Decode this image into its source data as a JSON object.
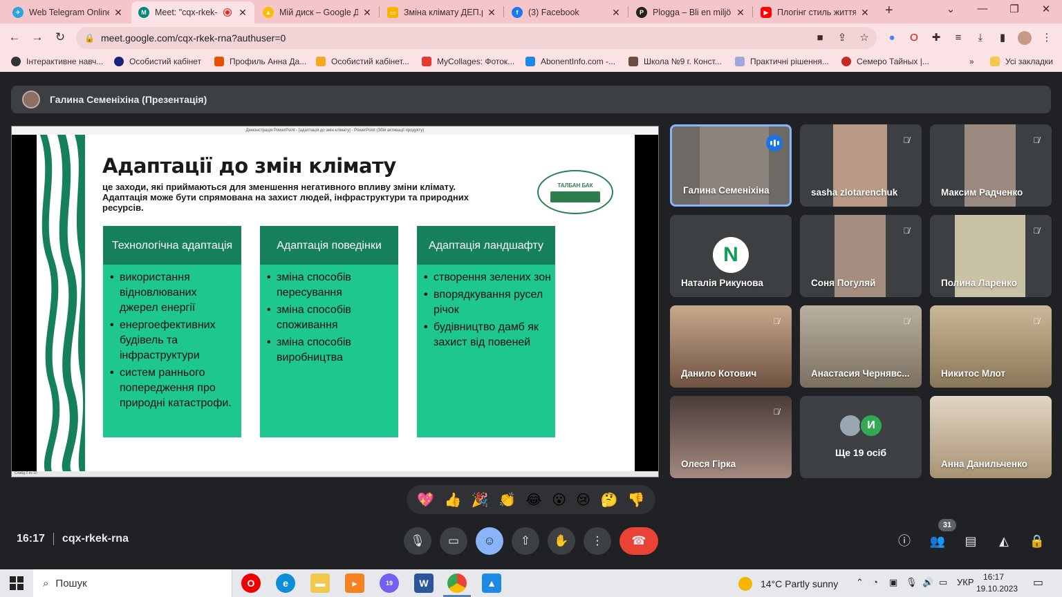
{
  "browser": {
    "tabs": [
      {
        "title": "Web Telegram Online",
        "fav_color": "#2aa3e0",
        "fav_glyph": "✈"
      },
      {
        "title": "Meet: \"cqx-rkek-",
        "fav_color": "#00897b",
        "fav_glyph": "M",
        "recording": true
      },
      {
        "title": "Мій диск – Google Д",
        "fav_color": "#fbbc04",
        "fav_glyph": "▲"
      },
      {
        "title": "Зміна клімату ДЕП.р",
        "fav_color": "#f4b400",
        "fav_glyph": "▭"
      },
      {
        "title": "(3) Facebook",
        "fav_color": "#1877f2",
        "fav_glyph": "f"
      },
      {
        "title": "Plogga – Bli en miljö",
        "fav_color": "#222222",
        "fav_glyph": "P"
      },
      {
        "title": "Плогінг стиль життя",
        "fav_color": "#ff0000",
        "fav_glyph": "▶"
      }
    ],
    "url": "meet.google.com/cqx-rkek-rna?authuser=0",
    "bookmarks": [
      {
        "label": "Інтерактивне навч...",
        "color": "#333333"
      },
      {
        "label": "Особистий кабінет",
        "color": "#1a237e"
      },
      {
        "label": "Профиль Анна Да...",
        "color": "#e65100"
      },
      {
        "label": "Особистий кабінет...",
        "color": "#f9a825"
      },
      {
        "label": "MyCollages: Фоток...",
        "color": "#e53935"
      },
      {
        "label": "AbonentInfo.com -...",
        "color": "#1e88e5"
      },
      {
        "label": "Школа №9 г. Конст...",
        "color": "#6d4c41"
      },
      {
        "label": "Практичні рішення...",
        "color": "#9fa8da"
      },
      {
        "label": "Семеро Тайных |...",
        "color": "#c62828"
      }
    ],
    "all_bookmarks": "Усі закладки",
    "more_bookmarks": "»"
  },
  "meet": {
    "presenter_label": "Галина Семеніхіна (Презентація)",
    "slide": {
      "window_title": "Демонстрація PowerPoint - [адаптація до змін клімату] - PowerPoint (Збій активації продукту)",
      "title": "Адаптації до змін клімату",
      "subtitle": "це заходи, які приймаються для зменшення негативного впливу зміни клімату. Адаптація може бути спрямована на захист людей, інфраструктури та природних ресурсів.",
      "logo_text": "ТАЛБАН БАК",
      "status_text": "Слайд 2 из 10",
      "columns": [
        {
          "header": "Технологічна адаптація",
          "items": [
            "використання відновлюваних джерел енергії",
            "енергоефективних будівель та інфраструктури",
            "систем раннього попередження про природні катастрофи."
          ]
        },
        {
          "header": "Адаптація поведінки",
          "items": [
            "зміна способів пересування",
            "зміна способів споживання",
            "зміна способів виробництва"
          ]
        },
        {
          "header": "Адаптація ландшафту",
          "items": [
            "створення зелених зон",
            "впорядкування русел річок",
            "будівництво дамб як захист від повеней"
          ]
        }
      ]
    },
    "participants": [
      {
        "name": "Галина Семеніхіна",
        "speaking": true,
        "bg": "#6d6a66"
      },
      {
        "name": "sasha zlotarenchuk",
        "muted": true,
        "bg": "#4a4d50"
      },
      {
        "name": "Максим Радченко",
        "muted": true,
        "bg": "#4a4d50"
      },
      {
        "name": "Наталія Рикунова",
        "initial": "N",
        "bg": "#3c4043"
      },
      {
        "name": "Соня Погуляй",
        "muted": true,
        "bg": "#4a4d50"
      },
      {
        "name": "Полина Ларенко",
        "muted": true,
        "bg": "#4a4d50"
      },
      {
        "name": "Данило Котович",
        "muted": true,
        "bg": "#7a5f4a"
      },
      {
        "name": "Анастасия Чернявс...",
        "muted": true,
        "bg": "#8a8478"
      },
      {
        "name": "Никитос Млот",
        "muted": true,
        "bg": "#9c8a6e"
      },
      {
        "name": "Олеся Гірка",
        "muted": true,
        "bg": "#5a4a46"
      },
      {
        "name": "Ще 19 осіб",
        "bg": "#3c4043"
      },
      {
        "name": "Анна Данильченко",
        "bg": "#b5a58e"
      }
    ],
    "more_initial": "И",
    "reactions": [
      "💖",
      "👍",
      "🎉",
      "👏",
      "😂",
      "😮",
      "😢",
      "🤔",
      "👎"
    ],
    "time": "16:17",
    "meeting_code": "cqx-rkek-rna",
    "people_count": "31"
  },
  "taskbar": {
    "search_placeholder": "Пошук",
    "weather": "14°C  Partly sunny",
    "language": "УКР",
    "time": "16:17",
    "date": "19.10.2023",
    "viber_badge": "19"
  }
}
